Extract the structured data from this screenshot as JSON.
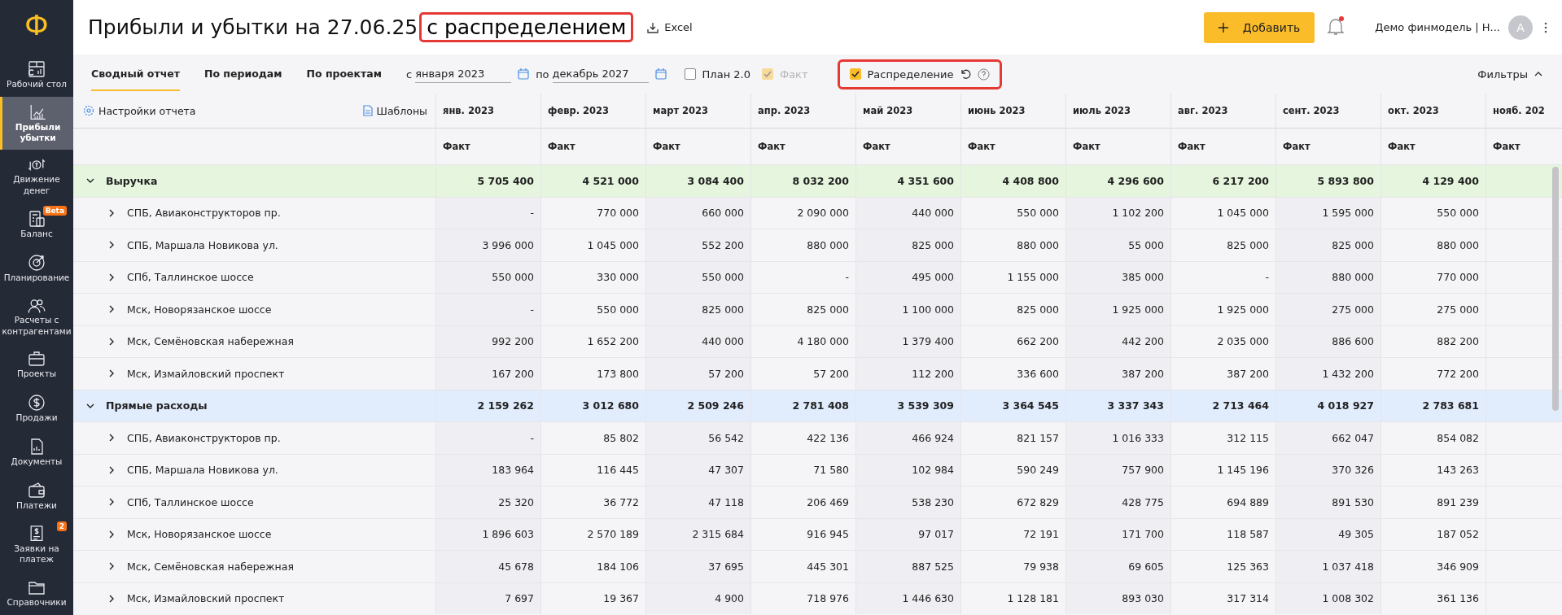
{
  "sidebar": {
    "logo": "Ф",
    "items": [
      {
        "label": "Рабочий стол",
        "selected": false
      },
      {
        "label": "Прибыли убытки",
        "selected": true
      },
      {
        "label": "Движение денег",
        "selected": false
      },
      {
        "label": "Баланс",
        "selected": false,
        "badge": "Beta"
      },
      {
        "label": "Планирование",
        "selected": false
      },
      {
        "label": "Расчеты с контрагентами",
        "selected": false
      },
      {
        "label": "Проекты",
        "selected": false
      },
      {
        "label": "Продажи",
        "selected": false
      },
      {
        "label": "Документы",
        "selected": false
      },
      {
        "label": "Платежи",
        "selected": false
      },
      {
        "label": "Заявки на платеж",
        "selected": false,
        "badge": "2"
      },
      {
        "label": "Справочники",
        "selected": false
      }
    ]
  },
  "header": {
    "title": "Прибыли и убытки на 27.06.25",
    "title_highlight": "с распределением",
    "export": "Excel",
    "add_button": "Добавить",
    "notifications_dot": true,
    "account": "Демо финмодель | Н...",
    "avatar": "A"
  },
  "toolbar": {
    "tabs": [
      {
        "label": "Сводный отчет",
        "selected": true
      },
      {
        "label": "По периодам",
        "selected": false
      },
      {
        "label": "По проектам",
        "selected": false
      }
    ],
    "date_from": {
      "label": "с",
      "value": "января 2023"
    },
    "date_to": {
      "label": "по",
      "value": "декабрь 2027"
    },
    "checkboxes": [
      {
        "label": "План 2.0",
        "checked": false,
        "disabled": false,
        "highlighted": false
      },
      {
        "label": "Факт",
        "checked": true,
        "disabled": true,
        "highlighted": false
      },
      {
        "label": "Распределение",
        "checked": true,
        "disabled": false,
        "highlighted": true
      }
    ],
    "filters": "Фильтры"
  },
  "table": {
    "settings": "Настройки отчета",
    "templates": "Шаблоны",
    "columns": [
      "янв. 2023",
      "февр. 2023",
      "март 2023",
      "апр. 2023",
      "май 2023",
      "июнь 2023",
      "июль 2023",
      "авг. 2023",
      "сент. 2023",
      "окт. 2023",
      "нояб. 202"
    ],
    "subheader": [
      "Факт",
      "Факт",
      "Факт",
      "Факт",
      "Факт",
      "Факт",
      "Факт",
      "Факт",
      "Факт",
      "Факт",
      "Факт"
    ],
    "groups": [
      {
        "name": "Выручка",
        "expanded": true,
        "color": "#e6f5de",
        "values": [
          "5 705 400",
          "4 521 000",
          "3 084 400",
          "8 032 200",
          "4 351 600",
          "4 408 800",
          "4 296 600",
          "6 217 200",
          "5 893 800",
          "4 129 400"
        ],
        "children": [
          {
            "name": "СПБ, Авиаконструкторов пр.",
            "expanded": false,
            "values": [
              "-",
              "770 000",
              "660 000",
              "2 090 000",
              "440 000",
              "550 000",
              "1 102 200",
              "1 045 000",
              "1 595 000",
              "550 000"
            ]
          },
          {
            "name": "СПБ, Маршала Новикова ул.",
            "expanded": false,
            "values": [
              "3 996 000",
              "1 045 000",
              "552 200",
              "880 000",
              "825 000",
              "880 000",
              "55 000",
              "825 000",
              "825 000",
              "880 000"
            ]
          },
          {
            "name": "СПб, Таллинское шоссе",
            "expanded": false,
            "values": [
              "550 000",
              "330 000",
              "550 000",
              "-",
              "495 000",
              "1 155 000",
              "385 000",
              "-",
              "880 000",
              "770 000"
            ]
          },
          {
            "name": "Мск, Новорязанское шоссе",
            "expanded": false,
            "values": [
              "-",
              "550 000",
              "825 000",
              "825 000",
              "1 100 000",
              "825 000",
              "1 925 000",
              "1 925 000",
              "275 000",
              "275 000"
            ]
          },
          {
            "name": "Мск, Семёновская набережная",
            "expanded": false,
            "values": [
              "992 200",
              "1 652 200",
              "440 000",
              "4 180 000",
              "1 379 400",
              "662 200",
              "442 200",
              "2 035 000",
              "886 600",
              "882 200"
            ]
          },
          {
            "name": "Мск, Измайловский проспект",
            "expanded": false,
            "values": [
              "167 200",
              "173 800",
              "57 200",
              "57 200",
              "112 200",
              "336 600",
              "387 200",
              "387 200",
              "1 432 200",
              "772 200"
            ]
          }
        ]
      },
      {
        "name": "Прямые расходы",
        "expanded": true,
        "color": "#e1ecfd",
        "values": [
          "2 159 262",
          "3 012 680",
          "2 509 246",
          "2 781 408",
          "3 539 309",
          "3 364 545",
          "3 337 343",
          "2 713 464",
          "4 018 927",
          "2 783 681"
        ],
        "children": [
          {
            "name": "СПБ, Авиаконструкторов пр.",
            "expanded": false,
            "values": [
              "-",
              "85 802",
              "56 542",
              "422 136",
              "466 924",
              "821 157",
              "1 016 333",
              "312 115",
              "662 047",
              "854 082"
            ]
          },
          {
            "name": "СПБ, Маршала Новикова ул.",
            "expanded": false,
            "values": [
              "183 964",
              "116 445",
              "47 307",
              "71 580",
              "102 984",
              "590 249",
              "757 900",
              "1 145 196",
              "370 326",
              "143 263"
            ]
          },
          {
            "name": "СПб, Таллинское шоссе",
            "expanded": false,
            "values": [
              "25 320",
              "36 772",
              "47 118",
              "206 469",
              "538 230",
              "672 829",
              "428 775",
              "694 889",
              "891 530",
              "891 239"
            ]
          },
          {
            "name": "Мск, Новорязанское шоссе",
            "expanded": false,
            "values": [
              "1 896 603",
              "2 570 189",
              "2 315 684",
              "916 945",
              "97 017",
              "72 191",
              "171 700",
              "118 587",
              "49 305",
              "187 052"
            ]
          },
          {
            "name": "Мск, Семёновская набережная",
            "expanded": false,
            "values": [
              "45 678",
              "184 106",
              "37 695",
              "445 301",
              "887 525",
              "79 938",
              "69 605",
              "125 363",
              "1 037 418",
              "346 909"
            ]
          },
          {
            "name": "Мск, Измайловский проспект",
            "expanded": false,
            "values": [
              "7 697",
              "19 367",
              "4 900",
              "718 976",
              "1 446 630",
              "1 128 181",
              "893 030",
              "317 314",
              "1 008 302",
              "361 136"
            ]
          }
        ]
      }
    ]
  }
}
